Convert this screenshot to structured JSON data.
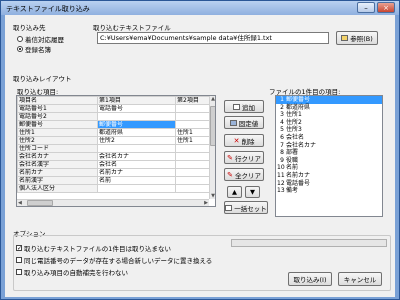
{
  "window": {
    "title": "テキストファイル取り込み"
  },
  "import_dest": {
    "label": "取り込み先",
    "options": [
      "着信対応履歴",
      "登録名簿"
    ],
    "selected": 1
  },
  "text_file": {
    "label": "取り込むテキストファイル",
    "path": "C:¥Users¥ema¥Documents¥sample data¥住所録1.txt",
    "browse_label": "参照(B)"
  },
  "layout_label": "取り込みレイアウト",
  "items_label": "取り込む項目:",
  "file_items_label": "ファイルの1件目の項目:",
  "grid": {
    "headers": [
      "項目名",
      "第1項目",
      "第2項目"
    ],
    "rows": [
      [
        "電話番号1",
        "電話番号",
        ""
      ],
      [
        "電話番号2",
        "",
        ""
      ],
      [
        "郵便番号",
        "郵便番号",
        ""
      ],
      [
        "住所1",
        "都道府県",
        "住所1"
      ],
      [
        "住所2",
        "住所2",
        "住所1"
      ],
      [
        "住所コード",
        "",
        ""
      ],
      [
        "会社名カナ",
        "会社名カナ",
        ""
      ],
      [
        "会社名漢字",
        "会社名",
        ""
      ],
      [
        "名前カナ",
        "名前カナ",
        ""
      ],
      [
        "名前漢字",
        "名前",
        ""
      ],
      [
        "個人法人区分",
        "",
        ""
      ]
    ],
    "selected_row": 2
  },
  "buttons": {
    "add": "追加",
    "fixed": "固定値",
    "delete": "削除",
    "row_clear": "行クリア",
    "all_clear": "全クリア",
    "up": "▲",
    "down": "▼",
    "bulk_set": "一括セット",
    "import": "取り込み(I)",
    "cancel": "キャンセル"
  },
  "file_items": [
    {
      "n": "1",
      "label": "郵便番号"
    },
    {
      "n": "2",
      "label": "都道府県"
    },
    {
      "n": "3",
      "label": "住所1"
    },
    {
      "n": "4",
      "label": "住所2"
    },
    {
      "n": "5",
      "label": "住所3"
    },
    {
      "n": "6",
      "label": "会社名"
    },
    {
      "n": "7",
      "label": "会社名カナ"
    },
    {
      "n": "8",
      "label": "部署"
    },
    {
      "n": "9",
      "label": "役職"
    },
    {
      "n": "10",
      "label": "名前"
    },
    {
      "n": "11",
      "label": "名前カナ"
    },
    {
      "n": "12",
      "label": "電話番号"
    },
    {
      "n": "13",
      "label": "備考"
    }
  ],
  "file_items_selected": 0,
  "options": {
    "label": "オプション",
    "checks": [
      {
        "label": "取り込むテキストファイルの1件目は取り込まない",
        "checked": true
      },
      {
        "label": "同じ電話番号のデータが存在する場合新しいデータに置き換える",
        "checked": false
      },
      {
        "label": "取り込み項目の自動補完を行わない",
        "checked": false
      }
    ]
  },
  "progress": 0
}
